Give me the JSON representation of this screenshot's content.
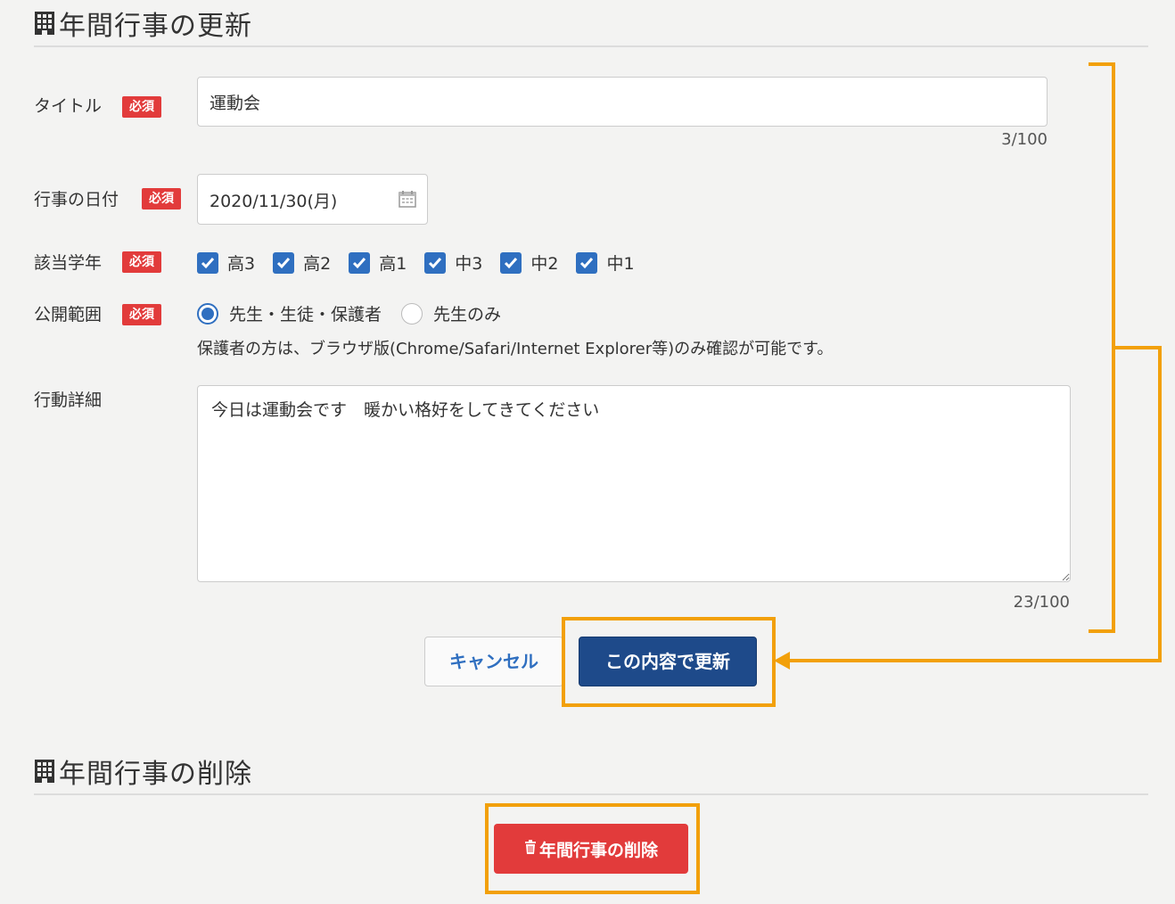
{
  "update_section": {
    "title": "年間行事の更新",
    "required_badge": "必須",
    "title_field": {
      "label": "タイトル",
      "value": "運動会",
      "counter": "3/100"
    },
    "date_field": {
      "label": "行事の日付",
      "value": "2020/11/30(月)"
    },
    "grade_field": {
      "label": "該当学年",
      "options": [
        {
          "label": "高3",
          "checked": true
        },
        {
          "label": "高2",
          "checked": true
        },
        {
          "label": "高1",
          "checked": true
        },
        {
          "label": "中3",
          "checked": true
        },
        {
          "label": "中2",
          "checked": true
        },
        {
          "label": "中1",
          "checked": true
        }
      ]
    },
    "visibility_field": {
      "label": "公開範囲",
      "options": [
        {
          "label": "先生・生徒・保護者",
          "selected": true
        },
        {
          "label": "先生のみ",
          "selected": false
        }
      ],
      "note": "保護者の方は、ブラウザ版(Chrome/Safari/Internet Explorer等)のみ確認が可能です。"
    },
    "detail_field": {
      "label": "行動詳細",
      "value": "今日は運動会です　暖かい格好をしてきてください",
      "counter": "23/100"
    },
    "cancel_label": "キャンセル",
    "update_label": "この内容で更新"
  },
  "delete_section": {
    "title": "年間行事の削除",
    "delete_label": "年間行事の削除"
  },
  "colors": {
    "accent_blue": "#2f6fc0",
    "update_button": "#1e4a8a",
    "danger": "#e23b3b",
    "highlight": "#f2a00a"
  }
}
